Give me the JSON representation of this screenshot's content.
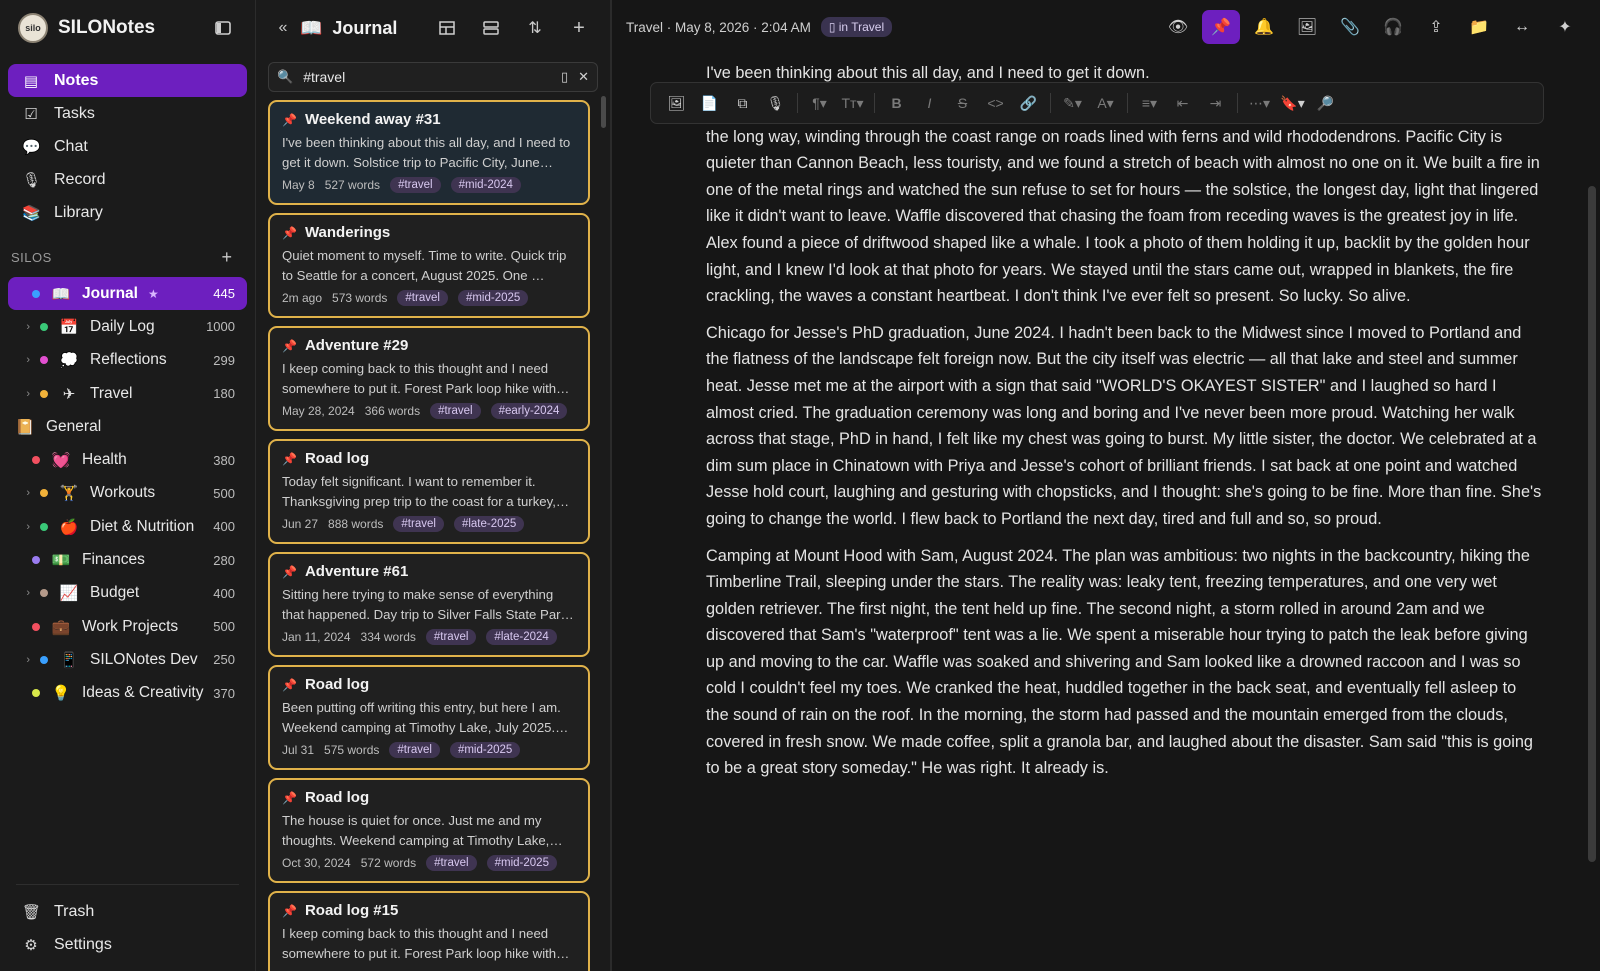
{
  "app": {
    "name": "SILONotes",
    "logo_text": "silo"
  },
  "nav": [
    {
      "label": "Notes",
      "icon": "notes-icon",
      "glyph": "▤",
      "active": true
    },
    {
      "label": "Tasks",
      "icon": "tasks-icon",
      "glyph": "☑",
      "active": false
    },
    {
      "label": "Chat",
      "icon": "chat-icon",
      "glyph": "💬",
      "active": false
    },
    {
      "label": "Record",
      "icon": "microphone-icon",
      "glyph": "🎙",
      "active": false
    },
    {
      "label": "Library",
      "icon": "library-icon",
      "glyph": "📚",
      "active": false
    }
  ],
  "silos": {
    "heading": "SILOS",
    "add": "+",
    "items": [
      {
        "name": "Journal",
        "count": "445",
        "star": "★",
        "dot": "#3aa0ff",
        "glyph": "📖",
        "active": true,
        "child": false
      },
      {
        "name": "Daily Log",
        "count": "1000",
        "dot": "#3ac878",
        "glyph": "📅",
        "child": true
      },
      {
        "name": "Reflections",
        "count": "299",
        "dot": "#e24fd0",
        "glyph": "💭",
        "child": true
      },
      {
        "name": "Travel",
        "count": "180",
        "dot": "#f2b23a",
        "glyph": "✈",
        "child": true
      },
      {
        "name": "General",
        "count": "",
        "dot": "",
        "glyph": "📔",
        "child": false,
        "nodot": true
      },
      {
        "name": "Health",
        "count": "380",
        "dot": "#f25060",
        "glyph": "💓",
        "child": false
      },
      {
        "name": "Workouts",
        "count": "500",
        "dot": "#f2b23a",
        "glyph": "🏋",
        "child": true
      },
      {
        "name": "Diet & Nutrition",
        "count": "400",
        "dot": "#3ac878",
        "glyph": "🍎",
        "child": true
      },
      {
        "name": "Finances",
        "count": "280",
        "dot": "#9a7cf0",
        "glyph": "💵",
        "child": false
      },
      {
        "name": "Budget",
        "count": "400",
        "dot": "#b59a8a",
        "glyph": "📈",
        "child": true
      },
      {
        "name": "Work Projects",
        "count": "500",
        "dot": "#f25060",
        "glyph": "💼",
        "child": false
      },
      {
        "name": "SILONotes Dev",
        "count": "250",
        "dot": "#3aa0ff",
        "glyph": "📱",
        "child": true
      },
      {
        "name": "Ideas & Creativity",
        "count": "370",
        "dot": "#d8e84a",
        "glyph": "💡",
        "child": false
      }
    ]
  },
  "bottom": [
    {
      "label": "Trash",
      "icon": "trash-icon",
      "glyph": "🗑"
    },
    {
      "label": "Settings",
      "icon": "gear-icon",
      "glyph": "⚙"
    }
  ],
  "list": {
    "title": "Journal",
    "search_value": "#travel",
    "cards": [
      {
        "title": "Weekend away #31",
        "snippet": "I've been thinking about this all day, and I need to get it down. Solstice trip to Pacific City, June…",
        "date": "May 8",
        "words": "527 words",
        "tags": [
          "#travel",
          "#mid-2024"
        ]
      },
      {
        "title": "Wanderings",
        "snippet": "Quiet moment to myself. Time to write. Quick trip to Seattle for a concert, August 2025. One …",
        "date": "2m ago",
        "words": "573 words",
        "tags": [
          "#travel",
          "#mid-2025"
        ]
      },
      {
        "title": "Adventure #29",
        "snippet": "I keep coming back to this thought and I need somewhere to put it. Forest Park loop hike with…",
        "date": "May 28, 2024",
        "words": "366 words",
        "tags": [
          "#travel",
          "#early-2024"
        ]
      },
      {
        "title": "Road log",
        "snippet": "Today felt significant. I want to remember it. Thanksgiving prep trip to the coast for a turkey,…",
        "date": "Jun 27",
        "words": "888 words",
        "tags": [
          "#travel",
          "#late-2025"
        ]
      },
      {
        "title": "Adventure #61",
        "snippet": "Sitting here trying to make sense of everything that happened. Day trip to Silver Falls State Par…",
        "date": "Jan 11, 2024",
        "words": "334 words",
        "tags": [
          "#travel",
          "#late-2024"
        ]
      },
      {
        "title": "Road log",
        "snippet": "Been putting off writing this entry, but here I am. Weekend camping at Timothy Lake, July 2025.…",
        "date": "Jul 31",
        "words": "575 words",
        "tags": [
          "#travel",
          "#mid-2025"
        ]
      },
      {
        "title": "Road log",
        "snippet": "The house is quiet for once. Just me and my thoughts. Weekend camping at Timothy Lake,…",
        "date": "Oct 30, 2024",
        "words": "572 words",
        "tags": [
          "#travel",
          "#mid-2025"
        ]
      },
      {
        "title": "Road log #15",
        "snippet": "I keep coming back to this thought and I need somewhere to put it. Forest Park loop hike with…",
        "date": "",
        "words": "",
        "tags": []
      }
    ]
  },
  "editor": {
    "crumb": "Travel · May 8, 2026 · 2:04 AM",
    "badge": "in Travel",
    "first_line": "I've been thinking about this all day, and I need to get it down.",
    "paragraphs": [
      "the long way, winding through the coast range on roads lined with ferns and wild rhododendrons. Pacific City is quieter than Cannon Beach, less touristy, and we found a stretch of beach with almost no one on it. We built a fire in one of the metal rings and watched the sun refuse to set for hours — the solstice, the longest day, light that lingered like it didn't want to leave. Waffle discovered that chasing the foam from receding waves is the greatest joy in life. Alex found a piece of driftwood shaped like a whale. I took a photo of them holding it up, backlit by the golden hour light, and I knew I'd look at that photo for years. We stayed until the stars came out, wrapped in blankets, the fire crackling, the waves a constant heartbeat. I don't think I've ever felt so present. So lucky. So alive.",
      "Chicago for Jesse's PhD graduation, June 2024. I hadn't been back to the Midwest since I moved to Portland and the flatness of the landscape felt foreign now. But the city itself was electric — all that lake and steel and summer heat. Jesse met me at the airport with a sign that said \"WORLD'S OKAYEST SISTER\" and I laughed so hard I almost cried. The graduation ceremony was long and boring and I've never been more proud. Watching her walk across that stage, PhD in hand, I felt like my chest was going to burst. My little sister, the doctor. We celebrated at a dim sum place in Chinatown with Priya and Jesse's cohort of brilliant friends. I sat back at one point and watched Jesse hold court, laughing and gesturing with chopsticks, and I thought: she's going to be fine. More than fine. She's going to change the world. I flew back to Portland the next day, tired and full and so, so proud.",
      "Camping at Mount Hood with Sam, August 2024. The plan was ambitious: two nights in the backcountry, hiking the Timberline Trail, sleeping under the stars. The reality was: leaky tent, freezing temperatures, and one very wet golden retriever. The first night, the tent held up fine. The second night, a storm rolled in around 2am and we discovered that Sam's \"waterproof\" tent was a lie. We spent a miserable hour trying to patch the leak before giving up and moving to the car. Waffle was soaked and shivering and Sam looked like a drowned raccoon and I was so cold I couldn't feel my toes. We cranked the heat, huddled together in the back seat, and eventually fell asleep to the sound of rain on the roof. In the morning, the storm had passed and the mountain emerged from the clouds, covered in fresh snow. We made coffee, split a granola bar, and laughed about the disaster. Sam said \"this is going to be a great story someday.\" He was right. It already is."
    ]
  }
}
